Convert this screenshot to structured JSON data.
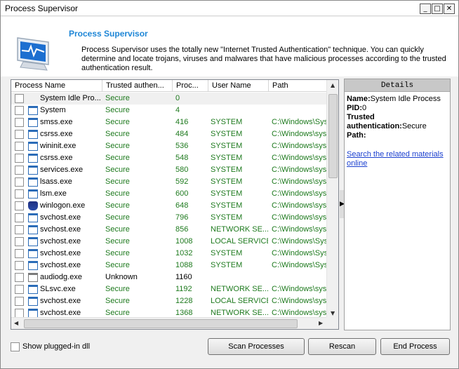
{
  "window": {
    "title": "Process Supervisor"
  },
  "header": {
    "app_name": "Process Supervisor",
    "description": "Process Supervisor uses the totally new \"Internet Trusted Authentication\" technique. You can quickly determine and locate trojans, viruses and malwares that have malicious processes according to the trusted authentication result."
  },
  "table": {
    "columns": [
      "Process Name",
      "Trusted authen...",
      "Proc...",
      "User Name",
      "Path"
    ],
    "rows": [
      {
        "name": "System Idle Pro...",
        "trust": "Secure",
        "pid": "0",
        "user": "",
        "path": "",
        "icon": "none"
      },
      {
        "name": "System",
        "trust": "Secure",
        "pid": "4",
        "user": "",
        "path": "",
        "icon": "app"
      },
      {
        "name": "smss.exe",
        "trust": "Secure",
        "pid": "416",
        "user": "SYSTEM",
        "path": "C:\\Windows\\Sys",
        "icon": "app"
      },
      {
        "name": "csrss.exe",
        "trust": "Secure",
        "pid": "484",
        "user": "SYSTEM",
        "path": "C:\\Windows\\syst",
        "icon": "app"
      },
      {
        "name": "wininit.exe",
        "trust": "Secure",
        "pid": "536",
        "user": "SYSTEM",
        "path": "C:\\Windows\\syst",
        "icon": "app"
      },
      {
        "name": "csrss.exe",
        "trust": "Secure",
        "pid": "548",
        "user": "SYSTEM",
        "path": "C:\\Windows\\syst",
        "icon": "app"
      },
      {
        "name": "services.exe",
        "trust": "Secure",
        "pid": "580",
        "user": "SYSTEM",
        "path": "C:\\Windows\\syst",
        "icon": "app"
      },
      {
        "name": "lsass.exe",
        "trust": "Secure",
        "pid": "592",
        "user": "SYSTEM",
        "path": "C:\\Windows\\syst",
        "icon": "app"
      },
      {
        "name": "lsm.exe",
        "trust": "Secure",
        "pid": "600",
        "user": "SYSTEM",
        "path": "C:\\Windows\\syst",
        "icon": "app"
      },
      {
        "name": "winlogon.exe",
        "trust": "Secure",
        "pid": "648",
        "user": "SYSTEM",
        "path": "C:\\Windows\\syst",
        "icon": "shield"
      },
      {
        "name": "svchost.exe",
        "trust": "Secure",
        "pid": "796",
        "user": "SYSTEM",
        "path": "C:\\Windows\\syst",
        "icon": "app"
      },
      {
        "name": "svchost.exe",
        "trust": "Secure",
        "pid": "856",
        "user": "NETWORK SE...",
        "path": "C:\\Windows\\syst",
        "icon": "app"
      },
      {
        "name": "svchost.exe",
        "trust": "Secure",
        "pid": "1008",
        "user": "LOCAL SERVICE",
        "path": "C:\\Windows\\Sys",
        "icon": "app"
      },
      {
        "name": "svchost.exe",
        "trust": "Secure",
        "pid": "1032",
        "user": "SYSTEM",
        "path": "C:\\Windows\\Sys",
        "icon": "app"
      },
      {
        "name": "svchost.exe",
        "trust": "Secure",
        "pid": "1088",
        "user": "SYSTEM",
        "path": "C:\\Windows\\Sys",
        "icon": "app"
      },
      {
        "name": "audiodg.exe",
        "trust": "Unknown",
        "pid": "1160",
        "user": "",
        "path": "",
        "icon": "sys"
      },
      {
        "name": "SLsvc.exe",
        "trust": "Secure",
        "pid": "1192",
        "user": "NETWORK SE...",
        "path": "C:\\Windows\\syst",
        "icon": "app"
      },
      {
        "name": "svchost.exe",
        "trust": "Secure",
        "pid": "1228",
        "user": "LOCAL SERVICE",
        "path": "C:\\Windows\\syst",
        "icon": "app"
      },
      {
        "name": "svchost.exe",
        "trust": "Secure",
        "pid": "1368",
        "user": "NETWORK SE...",
        "path": "C:\\Windows\\syst",
        "icon": "app"
      }
    ]
  },
  "details": {
    "header": "Details",
    "name_label": "Name:",
    "name_value": "System Idle Process",
    "pid_label": "PID:",
    "pid_value": "0",
    "trust_label": "Trusted authentication:",
    "trust_value": "Secure",
    "path_label": "Path:",
    "path_value": "",
    "link": "Search the related materials online"
  },
  "footer": {
    "show_dll_label": "Show plugged-in dll",
    "scan_button": "Scan Processes",
    "rescan_button": "Rescan",
    "end_button": "End Process"
  },
  "colors": {
    "accent": "#1e86d6",
    "secure_text": "#1e7a1e",
    "link": "#1a3fcf"
  }
}
